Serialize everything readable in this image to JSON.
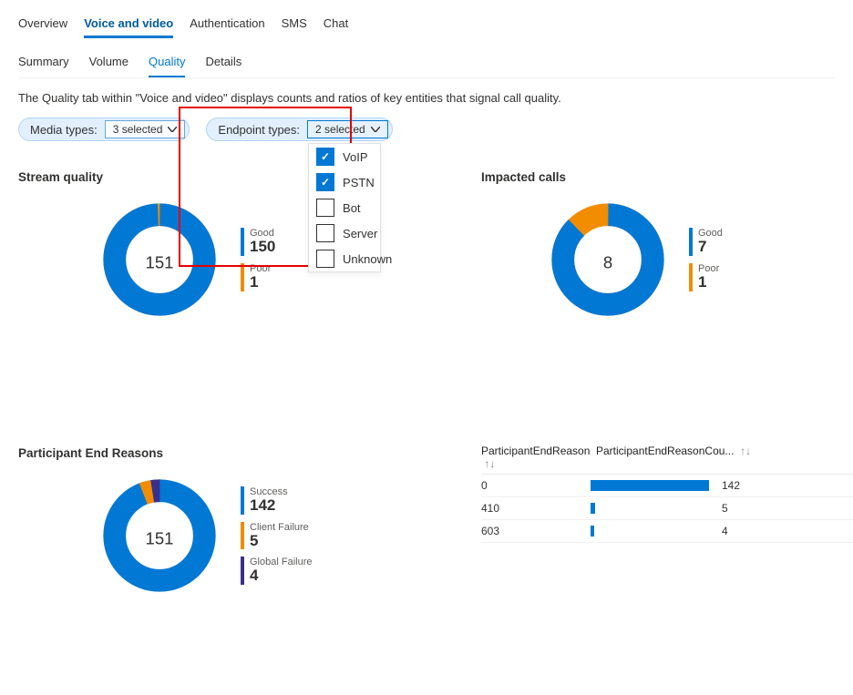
{
  "tabs": {
    "overview": "Overview",
    "voicevideo": "Voice and video",
    "auth": "Authentication",
    "sms": "SMS",
    "chat": "Chat"
  },
  "subtabs": {
    "summary": "Summary",
    "volume": "Volume",
    "quality": "Quality",
    "details": "Details"
  },
  "desc": "The Quality tab within \"Voice and video\" displays counts and ratios of key entities that signal call quality.",
  "filters": {
    "media_label": "Media types:",
    "media_sel": "3 selected",
    "endpoint_label": "Endpoint types:",
    "endpoint_sel": "2 selected",
    "endpoint_options": [
      {
        "name": "VoIP",
        "checked": true
      },
      {
        "name": "PSTN",
        "checked": true
      },
      {
        "name": "Bot",
        "checked": false
      },
      {
        "name": "Server",
        "checked": false
      },
      {
        "name": "Unknown",
        "checked": false
      }
    ]
  },
  "streamquality": {
    "title": "Stream quality",
    "center": "151",
    "legend": [
      {
        "label": "Good",
        "value": "150",
        "color": "#0078d4"
      },
      {
        "label": "Poor",
        "value": "1",
        "color": "#f28c00"
      }
    ]
  },
  "impactedcalls": {
    "title": "Impacted calls",
    "center": "8",
    "legend": [
      {
        "label": "Good",
        "value": "7",
        "color": "#0078d4"
      },
      {
        "label": "Poor",
        "value": "1",
        "color": "#f28c00"
      }
    ]
  },
  "endreasons": {
    "title": "Participant End Reasons",
    "center": "151",
    "legend": [
      {
        "label": "Success",
        "value": "142",
        "color": "#0078d4"
      },
      {
        "label": "Client Failure",
        "value": "5",
        "color": "#f28c00"
      },
      {
        "label": "Global Failure",
        "value": "4",
        "color": "#3b2e8c"
      }
    ]
  },
  "table": {
    "h1": "ParticipantEndReason",
    "h2": "ParticipantEndReasonCou...",
    "rows": [
      {
        "code": "0",
        "value": "142",
        "pct": 100
      },
      {
        "code": "410",
        "value": "5",
        "pct": 3.5
      },
      {
        "code": "603",
        "value": "4",
        "pct": 2.8
      }
    ]
  },
  "chart_data": [
    {
      "type": "pie",
      "title": "Stream quality",
      "series": [
        {
          "name": "Good",
          "value": 150
        },
        {
          "name": "Poor",
          "value": 1
        }
      ],
      "total_label": 151
    },
    {
      "type": "pie",
      "title": "Impacted calls",
      "series": [
        {
          "name": "Good",
          "value": 7
        },
        {
          "name": "Poor",
          "value": 1
        }
      ],
      "total_label": 8
    },
    {
      "type": "pie",
      "title": "Participant End Reasons",
      "series": [
        {
          "name": "Success",
          "value": 142
        },
        {
          "name": "Client Failure",
          "value": 5
        },
        {
          "name": "Global Failure",
          "value": 4
        }
      ],
      "total_label": 151
    },
    {
      "type": "bar",
      "title": "ParticipantEndReasonCount",
      "categories": [
        "0",
        "410",
        "603"
      ],
      "values": [
        142,
        5,
        4
      ],
      "xlabel": "ParticipantEndReason",
      "ylabel": "ParticipantEndReasonCount",
      "ylim": [
        0,
        142
      ]
    }
  ]
}
